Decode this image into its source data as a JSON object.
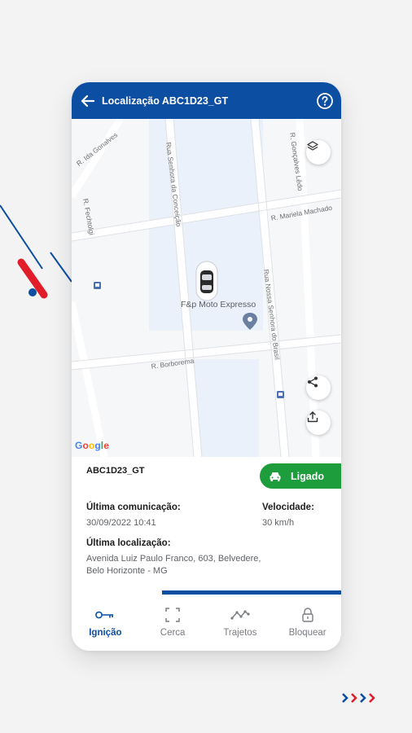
{
  "header": {
    "title": "Localização ABC1D23_GT",
    "back_icon": "arrow-left-icon",
    "help_icon": "help-circle-icon"
  },
  "map": {
    "streets": [
      "R. Ida Gonalves",
      "Rua Senhora da Conceição",
      "R. Gonçalves Lêdo",
      "R. Mariela Machado",
      "R. Fechtolgi",
      "Rua Nossa Senhora do Brasil",
      "R. Borborema"
    ],
    "poi_label": "F&p Moto Expresso",
    "attribution": "Google",
    "layers_icon": "layers-icon",
    "share_icon": "share-icon",
    "upload_icon": "upload-icon"
  },
  "vehicle": {
    "plate": "ABC1D23_GT",
    "status": "Ligado",
    "status_color": "#1e9d3d",
    "last_comm_label": "Última comunicação:",
    "last_comm_value": "30/09/2022 10:41",
    "speed_label": "Velocidade:",
    "speed_value": "30 km/h",
    "last_loc_label": "Última localização:",
    "last_loc_line1": "Avenida Luiz Paulo Franco, 603, Belvedere,",
    "last_loc_line2": "Belo Horizonte - MG",
    "progress_fraction": 0.66
  },
  "nav": {
    "items": [
      {
        "label": "Ignição",
        "icon": "key-icon",
        "active": true
      },
      {
        "label": "Cerca",
        "icon": "fence-frame-icon",
        "active": false
      },
      {
        "label": "Trajetos",
        "icon": "route-icon",
        "active": false
      },
      {
        "label": "Bloquear",
        "icon": "lock-icon",
        "active": false
      }
    ]
  },
  "colors": {
    "brand": "#0c4ea2",
    "accent_red": "#e11d2a",
    "status_on": "#1e9d3d"
  }
}
